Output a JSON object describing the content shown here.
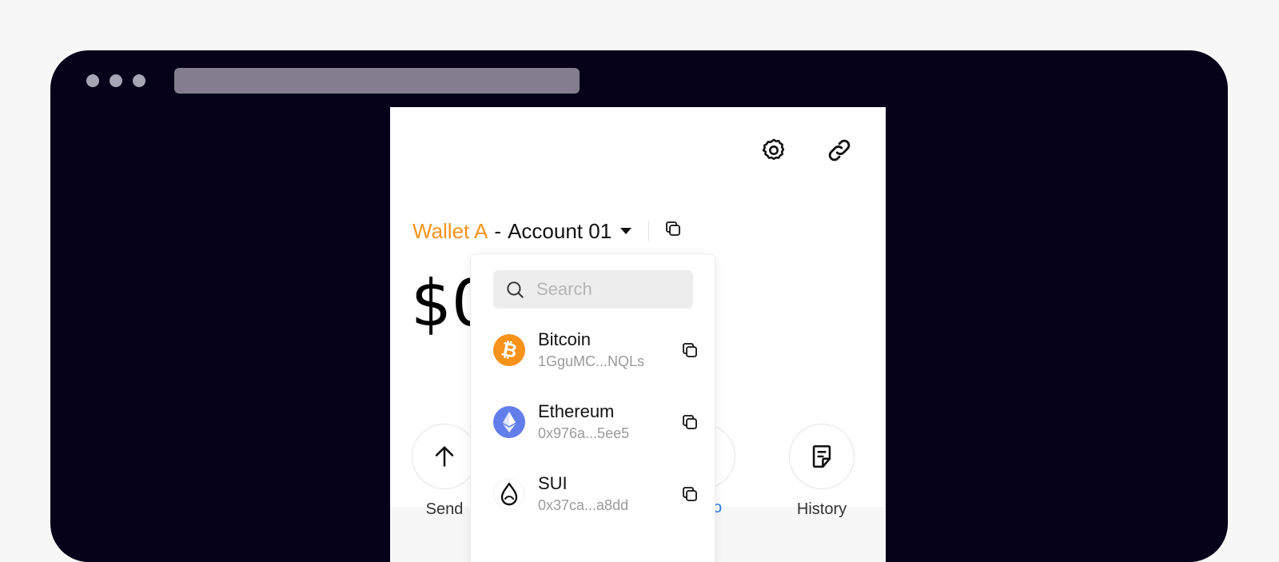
{
  "wallet": {
    "wallet_name": "Wallet A",
    "separator": "-",
    "account_name": "Account 01",
    "balance": "$0"
  },
  "actions": {
    "send_label": "Send",
    "history_label": "History",
    "partial_label": "o"
  },
  "dropdown": {
    "search_placeholder": "Search",
    "coins": [
      {
        "name": "Bitcoin",
        "address": "1GguMC...NQLs",
        "icon": "bitcoin-icon",
        "color": "#f7931a"
      },
      {
        "name": "Ethereum",
        "address": "0x976a...5ee5",
        "icon": "ethereum-icon",
        "color": "#627eea"
      },
      {
        "name": "SUI",
        "address": "0x37ca...a8dd",
        "icon": "sui-icon",
        "color": "#111111"
      }
    ]
  },
  "colors": {
    "accent": "#f7931a",
    "browser_bg": "#06021a",
    "address_bar": "#847f8e"
  }
}
